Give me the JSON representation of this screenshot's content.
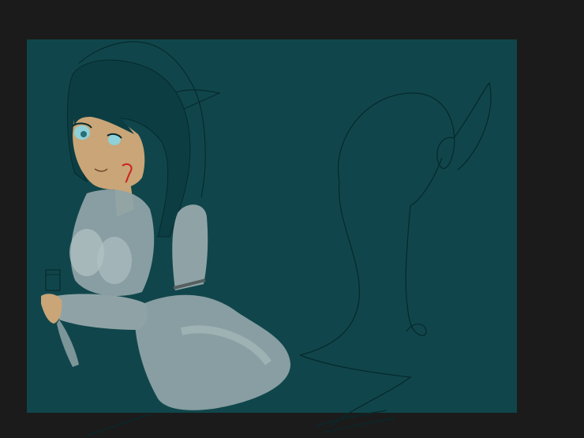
{
  "colors": {
    "backdrop": "#1b1b1b",
    "canvas": "#10464b",
    "line": "#062a2d",
    "hair": "#0c3d42",
    "skin": "#c9a577",
    "garment": "#8fa3a6",
    "garment_light": "#b4c3c4",
    "eye": "#8fd1d8",
    "blood": "#cc2222"
  },
  "artwork": {
    "subject": "anime-style-sketch",
    "elements": [
      "figure",
      "tail-sketch",
      "cup",
      "scribble-lines"
    ]
  }
}
